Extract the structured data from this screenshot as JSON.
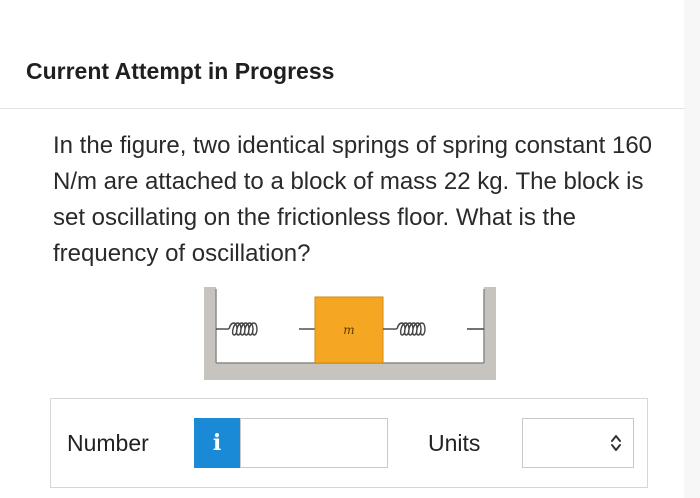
{
  "header": {
    "status": "Current Attempt in Progress"
  },
  "question": {
    "text": "In the figure, two identical springs of spring constant 160 N/m are attached to a block of mass 22 kg. The block is set oscillating on the frictionless floor. What is the frequency of oscillation?"
  },
  "figure": {
    "block_label": "m",
    "block_color": "#f5a623",
    "wall_color": "#bdbdbd"
  },
  "answer": {
    "number_label": "Number",
    "info_label": "i",
    "number_value": "",
    "units_label": "Units",
    "units_value": ""
  },
  "icons": {
    "info": "info-icon",
    "select": "chevron-updown-icon"
  },
  "colors": {
    "accent": "#1a8ad6"
  }
}
